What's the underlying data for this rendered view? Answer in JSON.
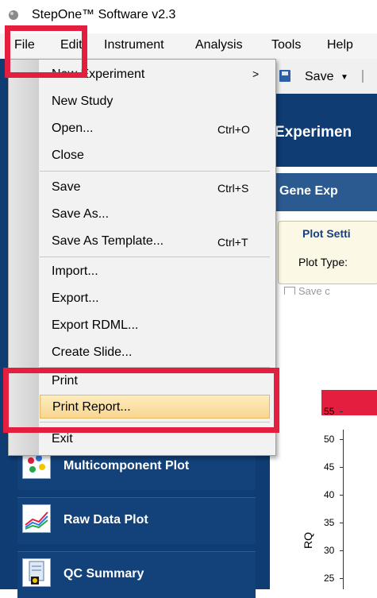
{
  "window": {
    "title": "StepOne™ Software v2.3",
    "icon": "stepone-logo-icon"
  },
  "menubar": {
    "items": [
      "File",
      "Edit",
      "Instrument",
      "Analysis",
      "Tools",
      "Help"
    ]
  },
  "toolbar": {
    "save_label": "Save"
  },
  "file_menu": {
    "items": [
      {
        "label": "New Experiment",
        "shortcut": "",
        "submenu": true
      },
      {
        "label": "New Study",
        "shortcut": ""
      },
      {
        "label": "Open...",
        "shortcut": "Ctrl+O"
      },
      {
        "label": "Close",
        "shortcut": ""
      },
      {
        "label": "Save",
        "shortcut": "Ctrl+S"
      },
      {
        "label": "Save As...",
        "shortcut": ""
      },
      {
        "label": "Save As Template...",
        "shortcut": "Ctrl+T"
      },
      {
        "label": "Import...",
        "shortcut": ""
      },
      {
        "label": "Export...",
        "shortcut": ""
      },
      {
        "label": "Export RDML...",
        "shortcut": ""
      },
      {
        "label": "Create Slide...",
        "shortcut": ""
      },
      {
        "label": "Print",
        "shortcut": ""
      },
      {
        "label": "Print Report...",
        "shortcut": "",
        "highlighted": true
      },
      {
        "label": "Exit",
        "shortcut": ""
      }
    ]
  },
  "nav": {
    "items": [
      {
        "label": "Multicomponent Plot",
        "icon": "multicomponent-plot-icon"
      },
      {
        "label": "Raw Data Plot",
        "icon": "raw-data-plot-icon"
      },
      {
        "label": "QC Summary",
        "icon": "qc-summary-icon"
      }
    ]
  },
  "main": {
    "header": "Experimen",
    "subheader": "Gene Exp",
    "plot_settings_title": "Plot Setti",
    "plot_type_label": "Plot Type:",
    "save_checkbox_label": "Save c"
  },
  "chart_data": {
    "type": "bar",
    "ylabel": "RQ",
    "yticks": [
      25,
      30,
      35,
      40,
      45,
      50,
      55
    ],
    "ylim": [
      23,
      56
    ]
  },
  "colors": {
    "highlight_box": "#e41e3f",
    "panel_navy": "#0f3c72",
    "menu_hover": "#f9d691"
  }
}
